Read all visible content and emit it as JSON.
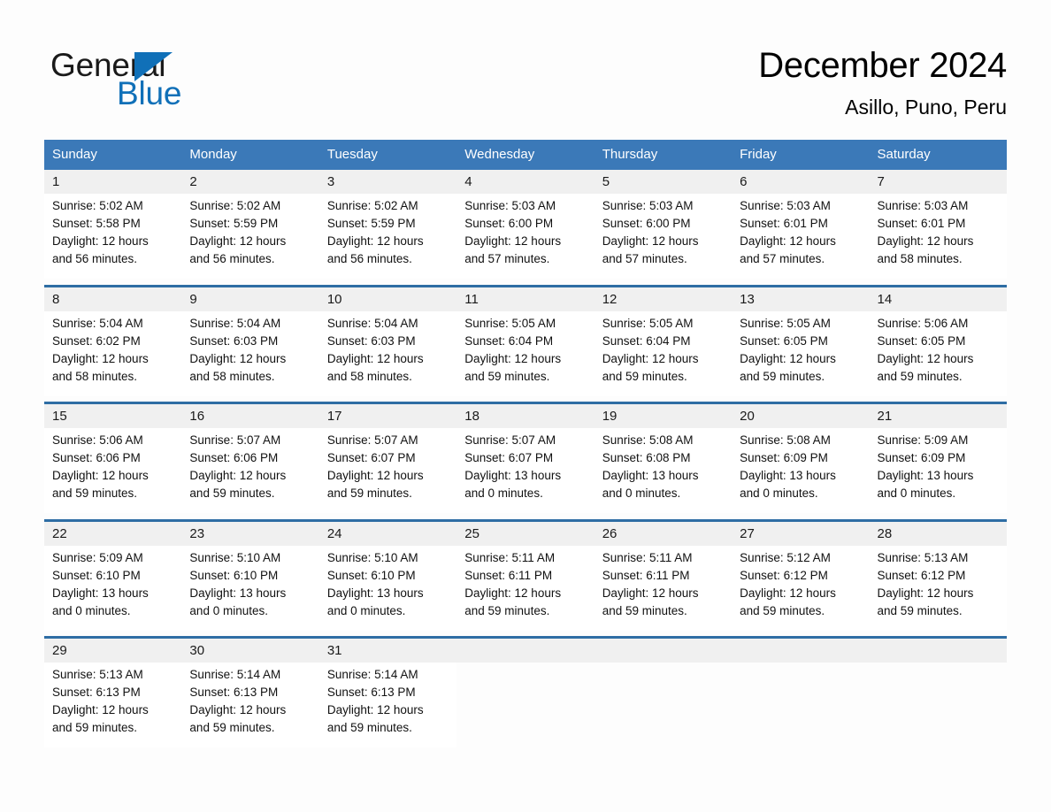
{
  "logo": {
    "word_one": "General",
    "word_two": "Blue",
    "triangle_icon": "blue-triangle-icon",
    "brand_color": "#1070b8"
  },
  "header": {
    "title": "December 2024",
    "subtitle": "Asillo, Puno, Peru"
  },
  "theme": {
    "header_blue": "#3b79b8",
    "row_separator_blue": "#2e6da4",
    "daynum_band_gray": "#f0f0f0"
  },
  "calendar": {
    "weekday_headers": [
      "Sunday",
      "Monday",
      "Tuesday",
      "Wednesday",
      "Thursday",
      "Friday",
      "Saturday"
    ],
    "weeks": [
      {
        "days": [
          {
            "day": "1",
            "sunrise": "Sunrise: 5:02 AM",
            "sunset": "Sunset: 5:58 PM",
            "daylight_1": "Daylight: 12 hours",
            "daylight_2": "and 56 minutes."
          },
          {
            "day": "2",
            "sunrise": "Sunrise: 5:02 AM",
            "sunset": "Sunset: 5:59 PM",
            "daylight_1": "Daylight: 12 hours",
            "daylight_2": "and 56 minutes."
          },
          {
            "day": "3",
            "sunrise": "Sunrise: 5:02 AM",
            "sunset": "Sunset: 5:59 PM",
            "daylight_1": "Daylight: 12 hours",
            "daylight_2": "and 56 minutes."
          },
          {
            "day": "4",
            "sunrise": "Sunrise: 5:03 AM",
            "sunset": "Sunset: 6:00 PM",
            "daylight_1": "Daylight: 12 hours",
            "daylight_2": "and 57 minutes."
          },
          {
            "day": "5",
            "sunrise": "Sunrise: 5:03 AM",
            "sunset": "Sunset: 6:00 PM",
            "daylight_1": "Daylight: 12 hours",
            "daylight_2": "and 57 minutes."
          },
          {
            "day": "6",
            "sunrise": "Sunrise: 5:03 AM",
            "sunset": "Sunset: 6:01 PM",
            "daylight_1": "Daylight: 12 hours",
            "daylight_2": "and 57 minutes."
          },
          {
            "day": "7",
            "sunrise": "Sunrise: 5:03 AM",
            "sunset": "Sunset: 6:01 PM",
            "daylight_1": "Daylight: 12 hours",
            "daylight_2": "and 58 minutes."
          }
        ]
      },
      {
        "days": [
          {
            "day": "8",
            "sunrise": "Sunrise: 5:04 AM",
            "sunset": "Sunset: 6:02 PM",
            "daylight_1": "Daylight: 12 hours",
            "daylight_2": "and 58 minutes."
          },
          {
            "day": "9",
            "sunrise": "Sunrise: 5:04 AM",
            "sunset": "Sunset: 6:03 PM",
            "daylight_1": "Daylight: 12 hours",
            "daylight_2": "and 58 minutes."
          },
          {
            "day": "10",
            "sunrise": "Sunrise: 5:04 AM",
            "sunset": "Sunset: 6:03 PM",
            "daylight_1": "Daylight: 12 hours",
            "daylight_2": "and 58 minutes."
          },
          {
            "day": "11",
            "sunrise": "Sunrise: 5:05 AM",
            "sunset": "Sunset: 6:04 PM",
            "daylight_1": "Daylight: 12 hours",
            "daylight_2": "and 59 minutes."
          },
          {
            "day": "12",
            "sunrise": "Sunrise: 5:05 AM",
            "sunset": "Sunset: 6:04 PM",
            "daylight_1": "Daylight: 12 hours",
            "daylight_2": "and 59 minutes."
          },
          {
            "day": "13",
            "sunrise": "Sunrise: 5:05 AM",
            "sunset": "Sunset: 6:05 PM",
            "daylight_1": "Daylight: 12 hours",
            "daylight_2": "and 59 minutes."
          },
          {
            "day": "14",
            "sunrise": "Sunrise: 5:06 AM",
            "sunset": "Sunset: 6:05 PM",
            "daylight_1": "Daylight: 12 hours",
            "daylight_2": "and 59 minutes."
          }
        ]
      },
      {
        "days": [
          {
            "day": "15",
            "sunrise": "Sunrise: 5:06 AM",
            "sunset": "Sunset: 6:06 PM",
            "daylight_1": "Daylight: 12 hours",
            "daylight_2": "and 59 minutes."
          },
          {
            "day": "16",
            "sunrise": "Sunrise: 5:07 AM",
            "sunset": "Sunset: 6:06 PM",
            "daylight_1": "Daylight: 12 hours",
            "daylight_2": "and 59 minutes."
          },
          {
            "day": "17",
            "sunrise": "Sunrise: 5:07 AM",
            "sunset": "Sunset: 6:07 PM",
            "daylight_1": "Daylight: 12 hours",
            "daylight_2": "and 59 minutes."
          },
          {
            "day": "18",
            "sunrise": "Sunrise: 5:07 AM",
            "sunset": "Sunset: 6:07 PM",
            "daylight_1": "Daylight: 13 hours",
            "daylight_2": "and 0 minutes."
          },
          {
            "day": "19",
            "sunrise": "Sunrise: 5:08 AM",
            "sunset": "Sunset: 6:08 PM",
            "daylight_1": "Daylight: 13 hours",
            "daylight_2": "and 0 minutes."
          },
          {
            "day": "20",
            "sunrise": "Sunrise: 5:08 AM",
            "sunset": "Sunset: 6:09 PM",
            "daylight_1": "Daylight: 13 hours",
            "daylight_2": "and 0 minutes."
          },
          {
            "day": "21",
            "sunrise": "Sunrise: 5:09 AM",
            "sunset": "Sunset: 6:09 PM",
            "daylight_1": "Daylight: 13 hours",
            "daylight_2": "and 0 minutes."
          }
        ]
      },
      {
        "days": [
          {
            "day": "22",
            "sunrise": "Sunrise: 5:09 AM",
            "sunset": "Sunset: 6:10 PM",
            "daylight_1": "Daylight: 13 hours",
            "daylight_2": "and 0 minutes."
          },
          {
            "day": "23",
            "sunrise": "Sunrise: 5:10 AM",
            "sunset": "Sunset: 6:10 PM",
            "daylight_1": "Daylight: 13 hours",
            "daylight_2": "and 0 minutes."
          },
          {
            "day": "24",
            "sunrise": "Sunrise: 5:10 AM",
            "sunset": "Sunset: 6:10 PM",
            "daylight_1": "Daylight: 13 hours",
            "daylight_2": "and 0 minutes."
          },
          {
            "day": "25",
            "sunrise": "Sunrise: 5:11 AM",
            "sunset": "Sunset: 6:11 PM",
            "daylight_1": "Daylight: 12 hours",
            "daylight_2": "and 59 minutes."
          },
          {
            "day": "26",
            "sunrise": "Sunrise: 5:11 AM",
            "sunset": "Sunset: 6:11 PM",
            "daylight_1": "Daylight: 12 hours",
            "daylight_2": "and 59 minutes."
          },
          {
            "day": "27",
            "sunrise": "Sunrise: 5:12 AM",
            "sunset": "Sunset: 6:12 PM",
            "daylight_1": "Daylight: 12 hours",
            "daylight_2": "and 59 minutes."
          },
          {
            "day": "28",
            "sunrise": "Sunrise: 5:13 AM",
            "sunset": "Sunset: 6:12 PM",
            "daylight_1": "Daylight: 12 hours",
            "daylight_2": "and 59 minutes."
          }
        ]
      },
      {
        "days": [
          {
            "day": "29",
            "sunrise": "Sunrise: 5:13 AM",
            "sunset": "Sunset: 6:13 PM",
            "daylight_1": "Daylight: 12 hours",
            "daylight_2": "and 59 minutes."
          },
          {
            "day": "30",
            "sunrise": "Sunrise: 5:14 AM",
            "sunset": "Sunset: 6:13 PM",
            "daylight_1": "Daylight: 12 hours",
            "daylight_2": "and 59 minutes."
          },
          {
            "day": "31",
            "sunrise": "Sunrise: 5:14 AM",
            "sunset": "Sunset: 6:13 PM",
            "daylight_1": "Daylight: 12 hours",
            "daylight_2": "and 59 minutes."
          },
          {
            "day": "",
            "sunrise": "",
            "sunset": "",
            "daylight_1": "",
            "daylight_2": ""
          },
          {
            "day": "",
            "sunrise": "",
            "sunset": "",
            "daylight_1": "",
            "daylight_2": ""
          },
          {
            "day": "",
            "sunrise": "",
            "sunset": "",
            "daylight_1": "",
            "daylight_2": ""
          },
          {
            "day": "",
            "sunrise": "",
            "sunset": "",
            "daylight_1": "",
            "daylight_2": ""
          }
        ]
      }
    ]
  }
}
